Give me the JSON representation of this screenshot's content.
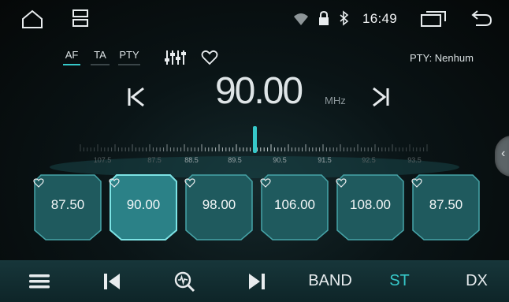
{
  "status_bar": {
    "icons": {
      "home": "home-icon",
      "multiwindow": "split-screen-icon",
      "wifi": "wifi-icon",
      "lock": "lock-icon",
      "bluetooth": "bluetooth-icon",
      "recent": "recent-apps-icon",
      "back": "back-icon"
    },
    "time": "16:49"
  },
  "toggles": [
    {
      "label": "AF",
      "active": true
    },
    {
      "label": "TA",
      "active": false
    },
    {
      "label": "PTY",
      "active": false
    }
  ],
  "pty_display": "PTY: Nenhum",
  "frequency": {
    "value": "90.00",
    "unit": "MHz"
  },
  "dial": {
    "labels": [
      "107.5",
      "87.5",
      "88.5",
      "89.5",
      "90.5",
      "91.5",
      "92.5",
      "93.5"
    ],
    "emphasized": [
      "88.5",
      "89.5",
      "90.5",
      "91.5"
    ],
    "current": 90.0
  },
  "presets": [
    {
      "label": "87.50",
      "active": false
    },
    {
      "label": "90.00",
      "active": true
    },
    {
      "label": "98.00",
      "active": false
    },
    {
      "label": "106.00",
      "active": false
    },
    {
      "label": "108.00",
      "active": false
    },
    {
      "label": "87.50",
      "active": false
    }
  ],
  "bottom_bar": {
    "band_label": "BAND",
    "st_label": "ST",
    "dx_label": "DX"
  },
  "colors": {
    "accent": "#36c8c9",
    "background": "#050808",
    "bottom_bar": "#17363a",
    "preset_fill": "#2a6f74"
  },
  "side_handle": "‹"
}
